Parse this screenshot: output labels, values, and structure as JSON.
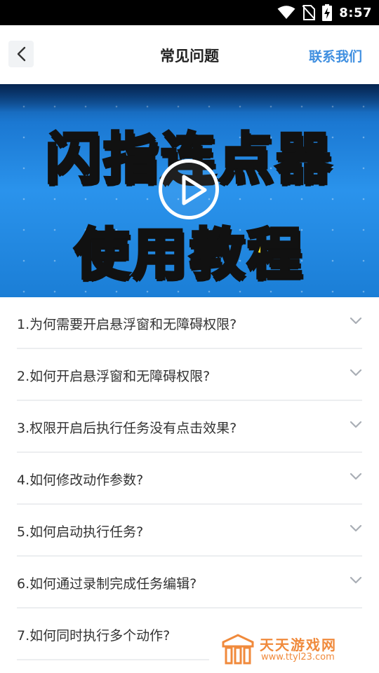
{
  "status_bar": {
    "time": "8:57",
    "icons": [
      "wifi-icon",
      "no-sim-icon",
      "battery-charging-icon"
    ]
  },
  "header": {
    "title": "常见问题",
    "contact_label": "联系我们",
    "back_icon": "chevron-left-icon"
  },
  "banner": {
    "line1": "闪指连点器",
    "line2": "使用教程",
    "play_icon": "play-icon",
    "text_color": "#f6df1c",
    "bg_color": "#2a93ec"
  },
  "faq": {
    "items": [
      {
        "question": "1.为何需要开启悬浮窗和无障碍权限?"
      },
      {
        "question": "2.如何开启悬浮窗和无障碍权限?"
      },
      {
        "question": "3.权限开启后执行任务没有点击效果?"
      },
      {
        "question": "4.如何修改动作参数?"
      },
      {
        "question": "5.如何启动执行任务?"
      },
      {
        "question": "6.如何通过录制完成任务编辑?"
      },
      {
        "question": "7.如何同时执行多个动作?"
      }
    ]
  },
  "watermark": {
    "brand": "天天游戏网",
    "url": "www.ttyl23.com"
  },
  "colors": {
    "accent": "#3f8fe0",
    "divider": "#eceef0",
    "watermark": "#f08a3c"
  }
}
